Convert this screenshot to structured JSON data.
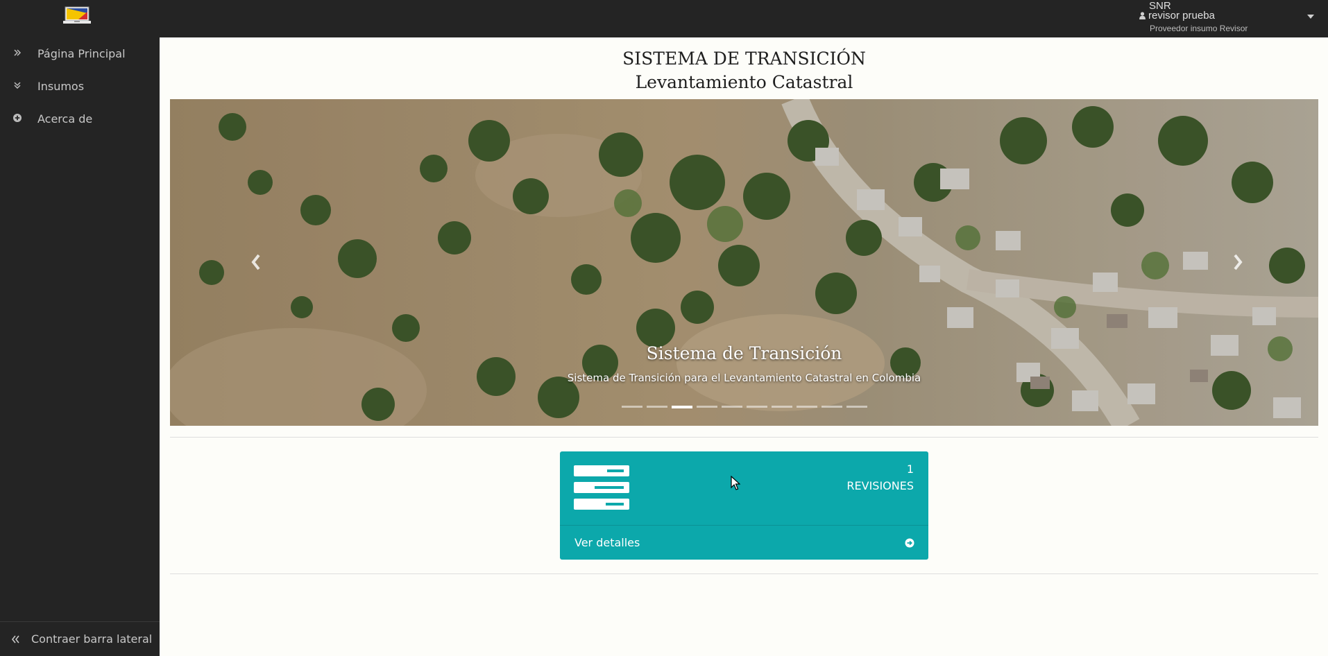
{
  "header": {
    "user": {
      "organization": "SNR",
      "name": "revisor prueba",
      "role": "Proveedor insumo Revisor"
    }
  },
  "sidebar": {
    "items": [
      {
        "label": "Página Principal",
        "icon": "double-chevron-right-icon"
      },
      {
        "label": "Insumos",
        "icon": "double-chevron-down-icon"
      },
      {
        "label": "Acerca de",
        "icon": "plus-circle-icon"
      }
    ],
    "collapse_label": "Contraer barra lateral"
  },
  "main": {
    "title": "SISTEMA DE TRANSICIÓN",
    "subtitle": "Levantamiento Catastral",
    "carousel": {
      "caption_title": "Sistema de Transición",
      "caption_text": "Sistema de Transición para el Levantamiento Catastral en Colombia",
      "slide_count": 10,
      "active_slide": 3
    },
    "panel": {
      "count": "1",
      "label": "REVISIONES",
      "footer_label": "Ver detalles",
      "color": "#0ca8ab"
    }
  }
}
